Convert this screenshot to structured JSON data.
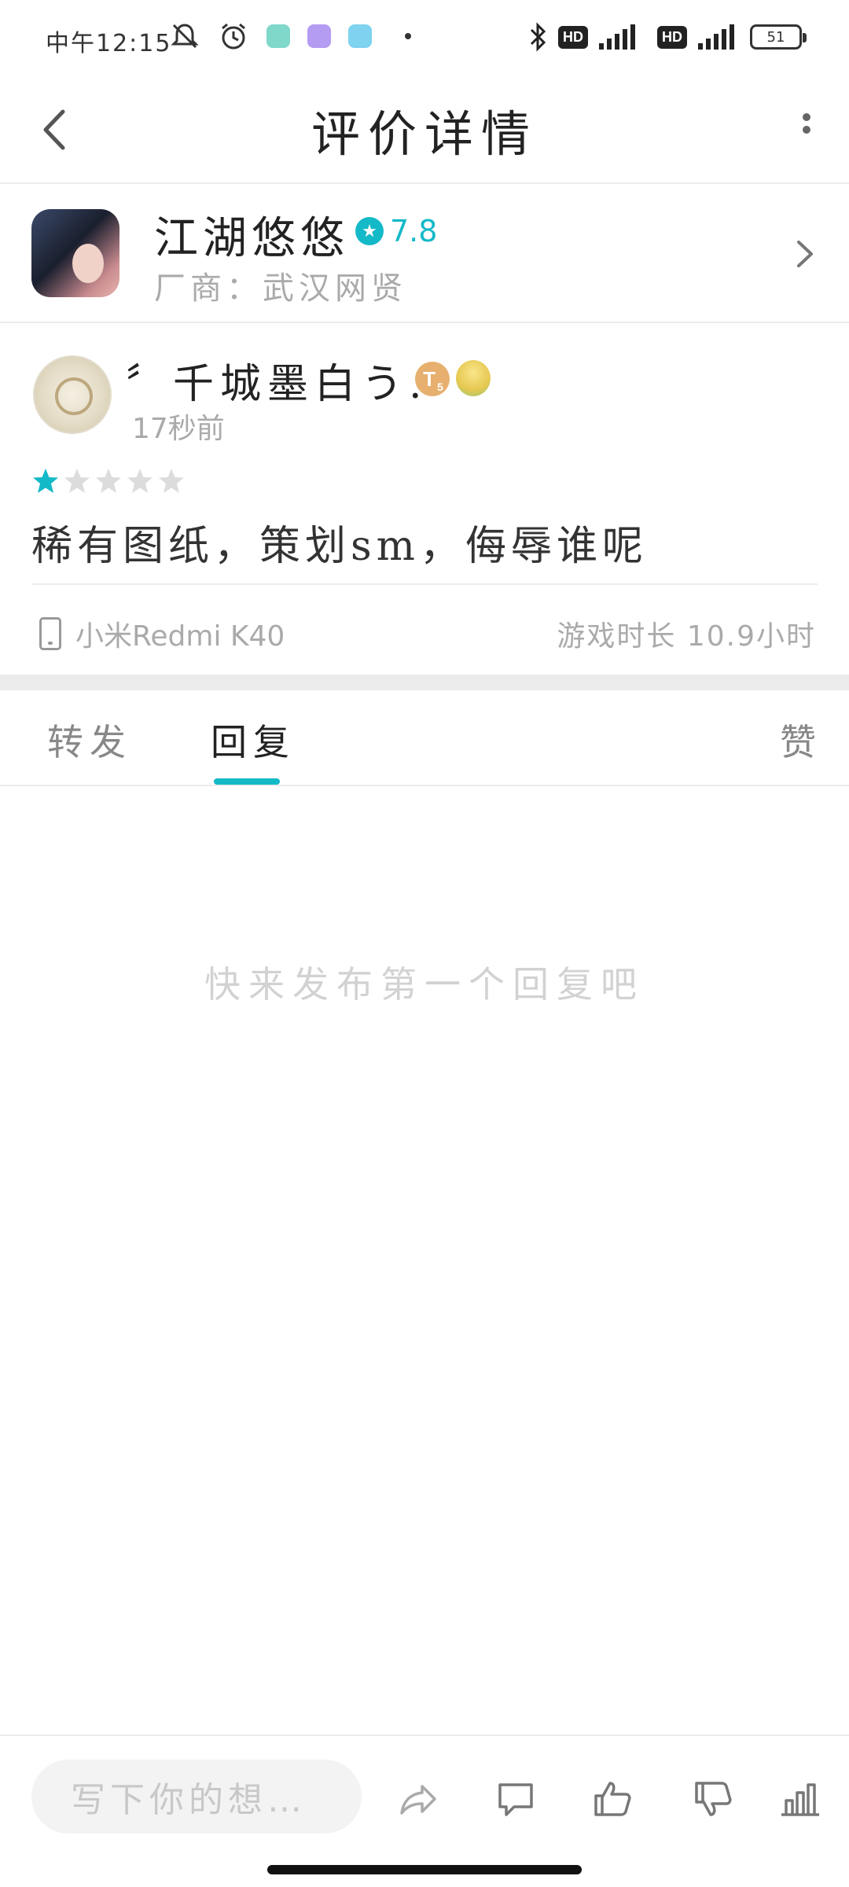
{
  "status_bar": {
    "time": "中午12:15",
    "battery": "51",
    "hd_label": "HD"
  },
  "header": {
    "title": "评价详情"
  },
  "game": {
    "name": "江湖悠悠",
    "rating": "7.8",
    "vendor": "厂商：武汉网贤"
  },
  "review": {
    "user_name": "〞千城墨白う.",
    "level_badge": "T",
    "level_num": "5",
    "time_ago": "17秒前",
    "stars_filled": 1,
    "stars_total": 5,
    "text": "稀有图纸，策划sm，侮辱谁呢",
    "device": "小米Redmi K40",
    "playtime": "游戏时长 10.9小时"
  },
  "tabs": {
    "forward": "转发",
    "reply": "回复",
    "like": "赞",
    "active": "reply"
  },
  "empty_state": "快来发布第一个回复吧",
  "bottom_bar": {
    "input_placeholder": "写下你的想…"
  },
  "colors": {
    "accent": "#14b9c8",
    "muted_text": "#aaaaaa",
    "divider": "#ececec"
  }
}
